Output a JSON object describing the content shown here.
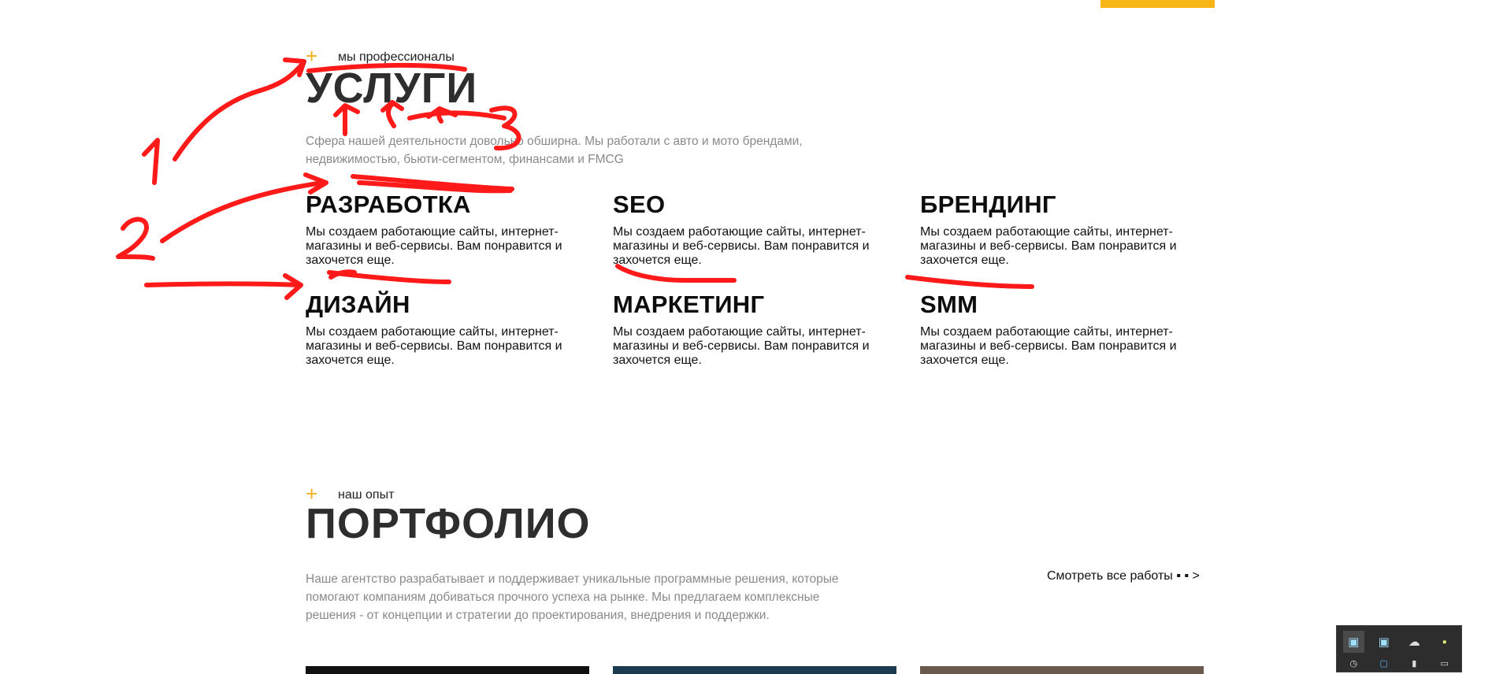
{
  "services": {
    "eyebrow": "мы профессионалы",
    "title": "УСЛУГИ",
    "lead_line1": "Сфера нашей деятельности довольно обширна. Мы работали с авто и мото брендами,",
    "lead_line2": "недвижимостью, бьюти-сегментом, финансами и FMCG",
    "items": [
      {
        "title": "РАЗРАБОТКА",
        "line1": "Мы создаем работающие сайты, интернет-",
        "line2": "магазины и веб-сервисы. Вам понравится и",
        "line3": "захочется еще."
      },
      {
        "title": "SEO",
        "line1": "Мы создаем работающие сайты, интернет-",
        "line2": "магазины и веб-сервисы. Вам понравится и",
        "line3": "захочется еще."
      },
      {
        "title": "БРЕНДИНГ",
        "line1": "Мы создаем работающие сайты, интернет-",
        "line2": "магазины и веб-сервисы. Вам понравится и",
        "line3": "захочется еще."
      },
      {
        "title": "ДИЗАЙН",
        "line1": "Мы создаем работающие сайты, интернет-",
        "line2": "магазины и веб-сервисы. Вам понравится и",
        "line3": "захочется еще."
      },
      {
        "title": "МАРКЕТИНГ",
        "line1": "Мы создаем работающие сайты, интернет-",
        "line2": "магазины и веб-сервисы. Вам понравится и",
        "line3": "захочется еще."
      },
      {
        "title": "SMM",
        "line1": "Мы создаем работающие сайты, интернет-",
        "line2": "магазины и веб-сервисы. Вам понравится и",
        "line3": "захочется еще."
      }
    ]
  },
  "portfolio": {
    "eyebrow": "наш опыт",
    "title": "ПОРТФОЛИО",
    "lead_line1": "Наше агентство разрабатывает и поддерживает уникальные программные решения, которые",
    "lead_line2": "помогают компаниям добиваться прочного успеха на рынке. Мы предлагаем комплексные",
    "lead_line3": "решения - от концепции и стратегии до проектирования, внедрения и поддержки.",
    "view_all": "Смотреть все работы ▪ ▪ >",
    "thumb_colors": [
      "#111111",
      "#1c3b4f",
      "#6a5a4e"
    ]
  },
  "annotations": {
    "num1": "1",
    "num2": "2",
    "num3": "3",
    "ink_color": "#ff1a1a"
  },
  "accent_color": "#f7b516",
  "tray": {
    "icons": [
      "cube-icon",
      "cube-icon",
      "cloud-icon",
      "note-icon"
    ]
  }
}
